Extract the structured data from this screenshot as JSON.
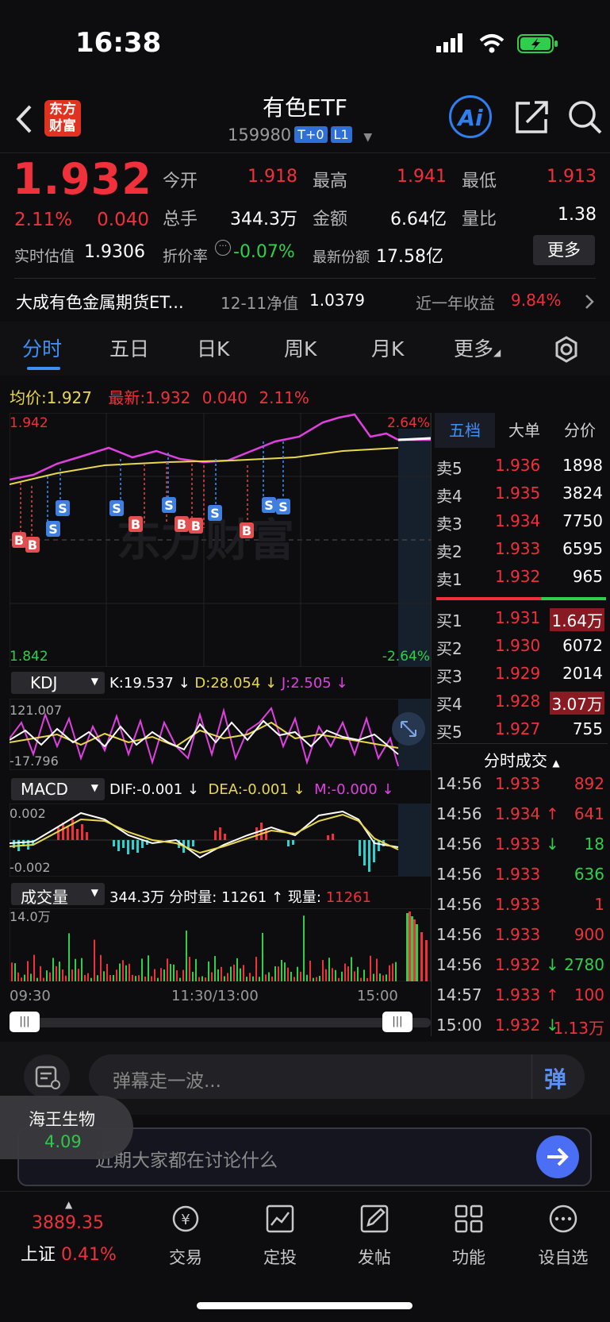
{
  "status": {
    "time": "16:38"
  },
  "header": {
    "title": "有色ETF",
    "code": "159980",
    "tag1": "T+0",
    "tag2": "L1",
    "logo_line1": "东方",
    "logo_line2": "财富",
    "ai_label": "Ai"
  },
  "quote": {
    "price": "1.932",
    "change_pct": "2.11%",
    "change": "0.040",
    "open_label": "今开",
    "open": "1.918",
    "high_label": "最高",
    "high": "1.941",
    "low_label": "最低",
    "low": "1.913",
    "volume_label": "总手",
    "volume": "344.3万",
    "amount_label": "金额",
    "amount": "6.64亿",
    "ratio_label": "量比",
    "ratio": "1.38",
    "est_label": "实时估值",
    "est": "1.9306",
    "discount_label": "折价率",
    "discount": "-0.07%",
    "shares_label": "最新份额",
    "shares": "17.58亿",
    "more": "更多"
  },
  "fund": {
    "name": "大成有色金属期货ET...",
    "nav_date_label": "12-11净值",
    "nav": "1.0379",
    "return_label": "近一年收益",
    "return": "9.84%"
  },
  "tabs": [
    "分时",
    "五日",
    "日K",
    "周K",
    "月K",
    "更多"
  ],
  "chart": {
    "avg_label": "均价:",
    "avg": "1.927",
    "latest_label": "最新:",
    "latest": "1.932",
    "latest_change": "0.040",
    "latest_pct": "2.11%",
    "top_price": "1.942",
    "bottom_price": "1.842",
    "top_pct": "2.64%",
    "bottom_pct": "-2.64%",
    "time_start": "09:30",
    "time_mid": "11:30/13:00",
    "time_end": "15:00",
    "watermark": "东方财富",
    "marker_b": "B",
    "marker_s": "S"
  },
  "kdj": {
    "name": "KDJ",
    "k": "K:19.537 ↓",
    "d": "D:28.054 ↓",
    "j": "J:2.505 ↓",
    "top": "121.007",
    "bottom": "-17.796"
  },
  "macd": {
    "name": "MACD",
    "dif": "DIF:-0.001 ↓",
    "dea": "DEA:-0.001 ↓",
    "m": "M:-0.000 ↓",
    "top": "0.002",
    "bottom": "-0.002"
  },
  "vol": {
    "name": "成交量",
    "total": "344.3万",
    "minute_label": "分时量:",
    "minute": "11261 ↑",
    "now_label": "现量:",
    "now": "11261",
    "top": "14.0万"
  },
  "orderbook": {
    "tabs": [
      "五档",
      "大单",
      "分价"
    ],
    "asks": [
      {
        "label": "卖5",
        "price": "1.936",
        "vol": "1898"
      },
      {
        "label": "卖4",
        "price": "1.935",
        "vol": "3824"
      },
      {
        "label": "卖3",
        "price": "1.934",
        "vol": "7750"
      },
      {
        "label": "卖2",
        "price": "1.933",
        "vol": "6595"
      },
      {
        "label": "卖1",
        "price": "1.932",
        "vol": "965"
      }
    ],
    "bids": [
      {
        "label": "买1",
        "price": "1.931",
        "vol": "1.64万"
      },
      {
        "label": "买2",
        "price": "1.930",
        "vol": "6072"
      },
      {
        "label": "买3",
        "price": "1.929",
        "vol": "2014"
      },
      {
        "label": "买4",
        "price": "1.928",
        "vol": "3.07万"
      },
      {
        "label": "买5",
        "price": "1.927",
        "vol": "755"
      }
    ]
  },
  "trades": {
    "title": "分时成交",
    "rows": [
      {
        "time": "14:56",
        "price": "1.933",
        "arrow": "",
        "vol": "892",
        "vcolor": "red"
      },
      {
        "time": "14:56",
        "price": "1.934",
        "arrow": "↑",
        "vol": "641",
        "vcolor": "red"
      },
      {
        "time": "14:56",
        "price": "1.933",
        "arrow": "↓",
        "vol": "18",
        "vcolor": "green"
      },
      {
        "time": "14:56",
        "price": "1.933",
        "arrow": "",
        "vol": "636",
        "vcolor": "green"
      },
      {
        "time": "14:56",
        "price": "1.933",
        "arrow": "",
        "vol": "1",
        "vcolor": "red"
      },
      {
        "time": "14:56",
        "price": "1.933",
        "arrow": "",
        "vol": "900",
        "vcolor": "red"
      },
      {
        "time": "14:56",
        "price": "1.932",
        "arrow": "↓",
        "vol": "2780",
        "vcolor": "green"
      },
      {
        "time": "14:57",
        "price": "1.933",
        "arrow": "↑",
        "vol": "100",
        "vcolor": "red"
      },
      {
        "time": "15:00",
        "price": "1.932",
        "arrow": "↓",
        "vol": "1.13万",
        "vcolor": "red"
      }
    ]
  },
  "comment": {
    "placeholder": "弹幕走一波...",
    "danmu": "弹"
  },
  "float_stock": {
    "name": "海王生物",
    "price": "4.09"
  },
  "ai_input": {
    "placeholder": "近期大家都在讨论什么"
  },
  "bottom_nav": {
    "index_value": "3889.35",
    "index_name": "上证",
    "index_pct": "0.41%",
    "items": [
      "交易",
      "定投",
      "发帖",
      "功能",
      "设自选"
    ]
  },
  "colors": {
    "up": "#f0303a",
    "down": "#2ed04b",
    "accent": "#3f8ff5",
    "avg_line": "#e8d84a",
    "price_line": "#e040e0"
  }
}
